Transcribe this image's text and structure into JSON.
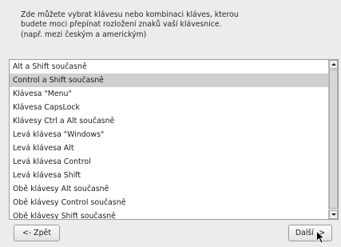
{
  "intro": {
    "lines": [
      "Zde můžete vybrat klávesu nebo kombinaci kláves, kterou",
      "budete moci přepínat rozložení znaků vaší klávesnice.",
      "(např. mezi českým a americkým)"
    ]
  },
  "options": {
    "items": [
      {
        "label": "Alt a Shift současně"
      },
      {
        "label": "Control a Shift současně"
      },
      {
        "label": "Klávesa \"Menu\""
      },
      {
        "label": "Klávesa CapsLock"
      },
      {
        "label": "Klávesy Ctrl a Alt současně"
      },
      {
        "label": "Levá klávesa \"Windows\""
      },
      {
        "label": "Levá klávesa Alt"
      },
      {
        "label": "Levá klávesa Control"
      },
      {
        "label": "Levá klávesa Shift"
      },
      {
        "label": "Obě klávesy Alt současně"
      },
      {
        "label": "Obě klávesy Control současně"
      },
      {
        "label": "Obě klávesy Shift současně"
      }
    ],
    "selected_label": "Control a Shift současně"
  },
  "buttons": {
    "back_label": "<- Zpět",
    "next_label": "Další ->"
  },
  "icons": {
    "scroll_up": "arrow-up-icon",
    "scroll_down": "arrow-down-icon",
    "cursor": "mouse-pointer-icon"
  }
}
